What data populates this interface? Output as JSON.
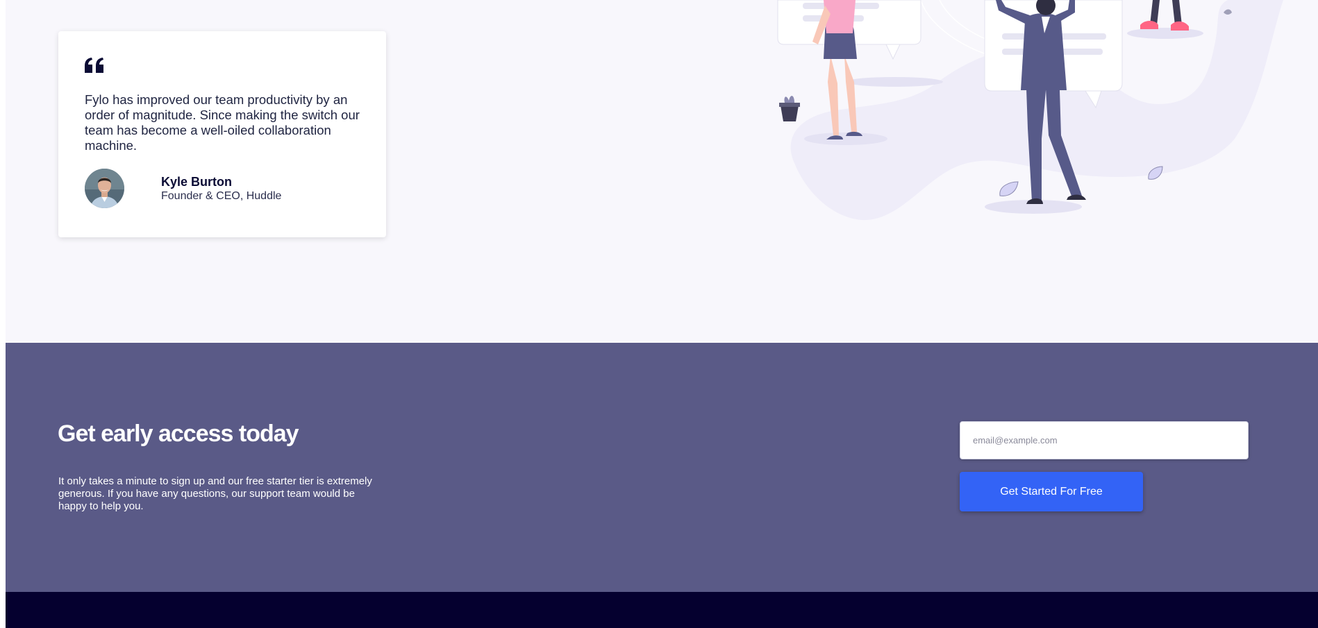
{
  "testimonial": {
    "quote": "Fylo has improved our team productivity by an order of magnitude. Since making the switch our team has become a well-oiled collaboration machine.",
    "author_name": "Kyle Burton",
    "author_title": "Founder & CEO, Huddle"
  },
  "cta": {
    "title": "Get early access today",
    "text": "It only takes a minute to sign up and our free starter tier is extremely generous. If you have any questions, our support team would be happy to help you.",
    "email_placeholder": "email@example.com",
    "button_label": "Get Started For Free"
  },
  "colors": {
    "hero_background": "#f8f7fc",
    "cta_background": "#5a5a87",
    "button": "#3363f6",
    "footer": "#05002f"
  },
  "icons": {
    "quote": "quote-icon",
    "avatar": "avatar"
  }
}
